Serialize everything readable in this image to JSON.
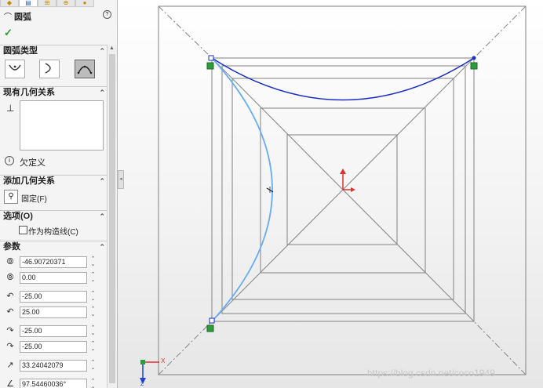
{
  "panel": {
    "title": "圆弧",
    "ok_glyph": "✓",
    "help_glyph": "?",
    "arc_type": {
      "heading": "圆弧类型",
      "selected_index": 2
    },
    "existing_relations": {
      "heading": "现有几何关系",
      "status": "欠定义"
    },
    "add_relations": {
      "heading": "添加几何关系",
      "fixed_label": "固定(F)"
    },
    "options": {
      "heading": "选项(O)",
      "construction_label": "作为构造线(C)",
      "construction_checked": false
    },
    "params": {
      "heading": "参数",
      "fields": [
        {
          "icon": "center-x-icon",
          "value": "-46.90720371"
        },
        {
          "icon": "center-y-icon",
          "value": "0.00"
        },
        {
          "icon": "start-x-icon",
          "value": "-25.00"
        },
        {
          "icon": "start-y-icon",
          "value": "25.00"
        },
        {
          "icon": "end-x-icon",
          "value": "-25.00"
        },
        {
          "icon": "end-y-icon",
          "value": "-25.00"
        },
        {
          "icon": "radius-icon",
          "value": "33.24042079"
        },
        {
          "icon": "angle-icon",
          "value": "97.54460036°"
        }
      ]
    }
  },
  "canvas": {
    "triad": {
      "x_label": "X",
      "z_label": "Z"
    },
    "watermark": "https://blog.csdn.net/coco1949",
    "colors": {
      "selected_arc": "#6aaef0",
      "existing_arc": "#1a2fbf",
      "geometry": "#8c8c8c",
      "constraint_marker": "#2e9b3c",
      "origin": "#e03030"
    }
  }
}
